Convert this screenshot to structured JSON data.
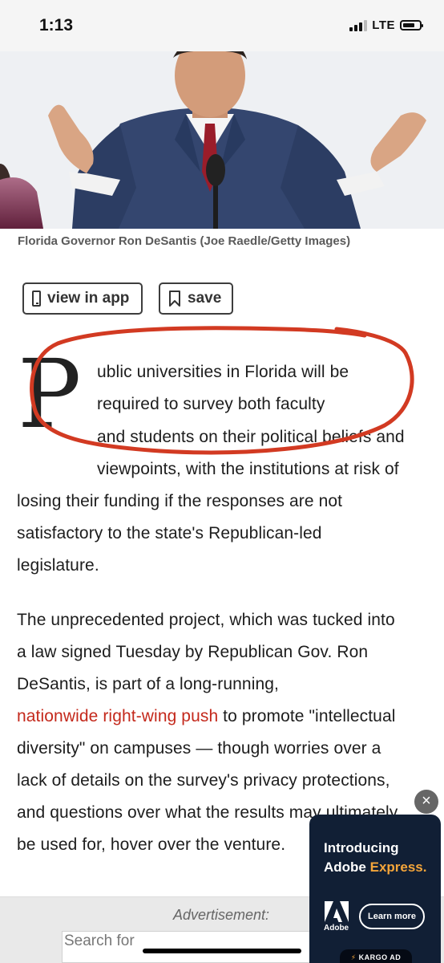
{
  "status_bar": {
    "time": "1:13",
    "network": "LTE",
    "signal_bars": 3,
    "battery_level": 0.75
  },
  "hero": {
    "caption": "Florida Governor Ron DeSantis (Joe Raedle/Getty Images)"
  },
  "actions": {
    "view_in_app": "view in app",
    "save": "save"
  },
  "article": {
    "drop_cap": "P",
    "lines": [
      "ublic universities in Florida will be",
      "required to survey both faculty",
      "and students on their political beliefs and",
      "viewpoints, with the institutions at risk of",
      "losing their funding if the responses are not",
      "satisfactory to the state's Republican-led",
      "legislature.",
      "The unprecedented project, which was tucked into",
      "a law signed Tuesday by Republican Gov. Ron",
      "DeSantis, is part of a long-running,",
      "nationwide right-wing push",
      " to promote \"intellectual",
      "diversity\" on campuses — though worries over a",
      "lack of details on the survey's privacy protections,",
      "and questions over what the results may ultimately",
      "be used for, hover over the venture."
    ]
  },
  "annotation": {
    "color": "#d23a22"
  },
  "ad_slot": {
    "label": "Advertisement:",
    "search_text": "Search for"
  },
  "ad": {
    "title_line1": "Introducing",
    "title_brand": "Adobe ",
    "title_product": "Express.",
    "brand": "Adobe",
    "cta": "Learn more",
    "network": "KARGO AD",
    "close_icon": "×"
  },
  "colors": {
    "link": "#c4291c",
    "ad_background": "#111f35",
    "ad_accent": "#f4a53a"
  }
}
